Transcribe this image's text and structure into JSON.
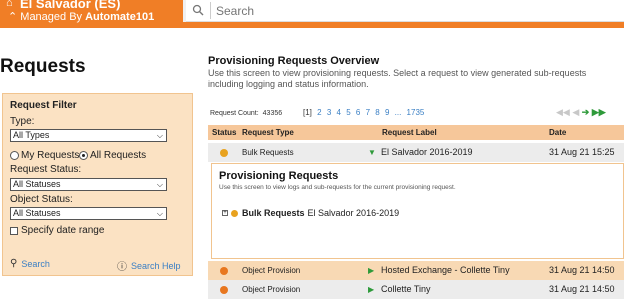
{
  "app": {
    "site_name": "El Salvador (ES)",
    "managed_by_prefix": "Managed By",
    "managed_by": "Automate101",
    "home_icon": "home-icon",
    "chevron_icon": "chevron-up-icon",
    "brand_color": "#f07e26"
  },
  "search": {
    "placeholder": "Search",
    "icon": "search-icon"
  },
  "left": {
    "page_title": "Requests",
    "filter": {
      "title": "Request Filter",
      "type_label": "Type:",
      "type_value": "All Types",
      "radio_my": "My Requests",
      "radio_all": "All Requests",
      "radio_selected": "All Requests",
      "request_status_label": "Request Status:",
      "request_status_value": "All Statuses",
      "object_status_label": "Object Status:",
      "object_status_value": "All Statuses",
      "date_range_label": "Specify date range",
      "search_link": "Search",
      "search_help_link": "Search Help"
    }
  },
  "main": {
    "title": "Provisioning Requests Overview",
    "description": "Use this screen to view provisioning requests. Select a request to view generated sub-requests including logging and status information.",
    "count_label": "Request Count:",
    "count_value": "43356",
    "pager": {
      "current": "[1]",
      "pages": [
        "2",
        "3",
        "4",
        "5",
        "6",
        "7",
        "8",
        "9"
      ],
      "ellipsis": "...",
      "last": "1735"
    },
    "columns": {
      "status": "Status",
      "type": "Request Type",
      "label": "Request Label",
      "date": "Date"
    },
    "rows": [
      {
        "status_color": "#e8a21f",
        "type": "Bulk Requests",
        "label": "El Salvador 2016-2019",
        "date": "31 Aug 21 15:25",
        "arrow": "down"
      },
      {
        "status_color": "#e8771f",
        "type": "Object Provision",
        "label": "Hosted Exchange - Collette Tiny",
        "date": "31 Aug 21 14:50",
        "arrow": "right"
      },
      {
        "status_color": "#e8771f",
        "type": "Object Provision",
        "label": "Collette Tiny",
        "date": "31 Aug 21 14:50",
        "arrow": "right"
      }
    ],
    "popup": {
      "title": "Provisioning Requests",
      "description": "Use this screen to view logs and sub-requests for the current provisioning request.",
      "tree_type": "Bulk Requests",
      "tree_label": "El Salvador 2016-2019"
    }
  }
}
